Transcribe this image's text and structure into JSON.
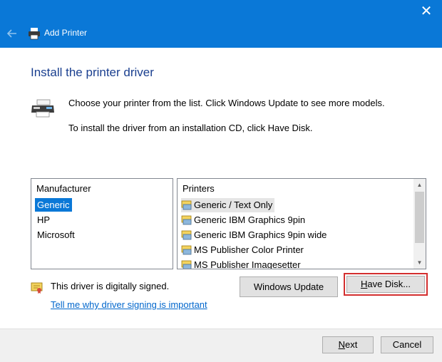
{
  "window": {
    "title": "Add Printer",
    "close_glyph": "✕"
  },
  "icons": {
    "back": "back-arrow-icon",
    "app": "printer-icon",
    "printer_large": "printer-icon",
    "signed": "certificate-icon",
    "driver": "printer-driver-icon"
  },
  "header": {
    "title": "Install the printer driver"
  },
  "instructions": {
    "line1": "Choose your printer from the list. Click Windows Update to see more models.",
    "line2": "To install the driver from an installation CD, click Have Disk."
  },
  "manufacturer_list": {
    "header": "Manufacturer",
    "items": [
      "Generic",
      "HP",
      "Microsoft"
    ],
    "selected": "Generic"
  },
  "printers_list": {
    "header": "Printers",
    "items": [
      "Generic / Text Only",
      "Generic IBM Graphics 9pin",
      "Generic IBM Graphics 9pin wide",
      "MS Publisher Color Printer",
      "MS Publisher Imagesetter"
    ],
    "selected": "Generic / Text Only"
  },
  "signing": {
    "status": "This driver is digitally signed.",
    "link": "Tell me why driver signing is important"
  },
  "buttons": {
    "windows_update": "Windows Update",
    "have_disk_u": "H",
    "have_disk_rest": "ave Disk...",
    "next_u": "N",
    "next_rest": "ext",
    "cancel": "Cancel"
  },
  "colors": {
    "accent": "#0a78d7",
    "highlight_outline": "#d32f2f",
    "header_text": "#1a3f8f",
    "link": "#0066cc"
  }
}
